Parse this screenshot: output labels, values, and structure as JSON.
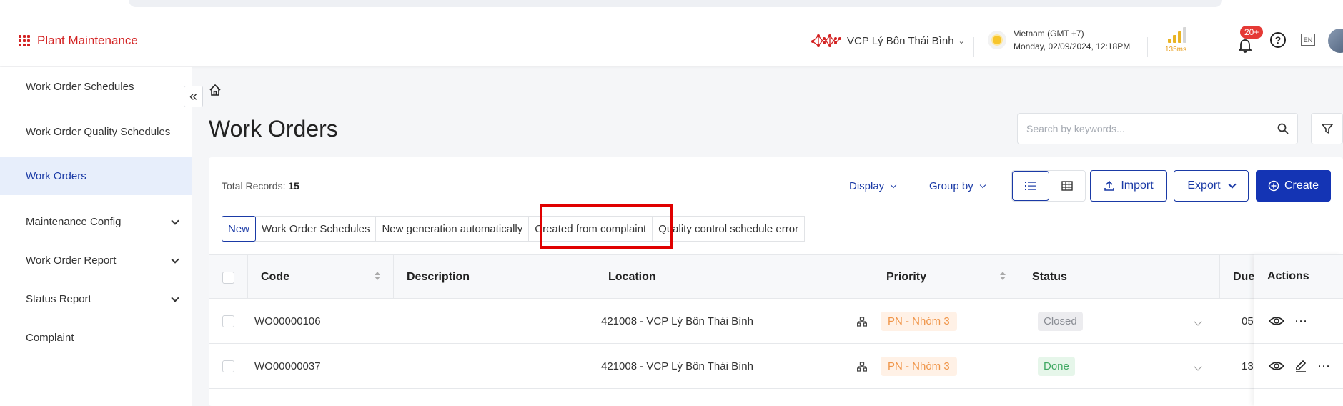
{
  "app": {
    "name": "Plant Maintenance"
  },
  "header": {
    "site": "VCP Lý Bôn Thái Bình",
    "timezone": "Vietnam (GMT +7)",
    "datetime": "Monday, 02/09/2024, 12:18PM",
    "latency": "135ms",
    "notifications": "20+",
    "language": "EN"
  },
  "sidebar": {
    "items": [
      {
        "label": "Work Order Schedules"
      },
      {
        "label": "Work Order Quality Schedules"
      },
      {
        "label": "Work Orders"
      },
      {
        "label": "Maintenance Config"
      },
      {
        "label": "Work Order Report"
      },
      {
        "label": "Status Report"
      },
      {
        "label": "Complaint"
      }
    ]
  },
  "page": {
    "title": "Work Orders",
    "search_placeholder": "Search by keywords...",
    "total_label": "Total Records:",
    "total_value": "15",
    "display_label": "Display",
    "groupby_label": "Group by",
    "import_label": "Import",
    "export_label": "Export",
    "create_label": "Create"
  },
  "filters": [
    "New",
    "Work Order Schedules",
    "New generation automatically",
    "Created from complaint",
    "Quality control schedule error"
  ],
  "table": {
    "columns": [
      "Code",
      "Description",
      "Location",
      "Priority",
      "Status",
      "Due",
      "Actions"
    ],
    "rows": [
      {
        "code": "WO00000106",
        "description": "",
        "location": "421008 - VCP Lý Bôn Thái Bình",
        "priority": "PN - Nhóm 3",
        "status": "Closed",
        "due": "05"
      },
      {
        "code": "WO00000037",
        "description": "",
        "location": "421008 - VCP Lý Bôn Thái Bình",
        "priority": "PN - Nhóm 3",
        "status": "Done",
        "due": "13"
      }
    ]
  },
  "colors": {
    "brand": "#d32323",
    "primary": "#1434b4",
    "highlight": "#e00000"
  }
}
